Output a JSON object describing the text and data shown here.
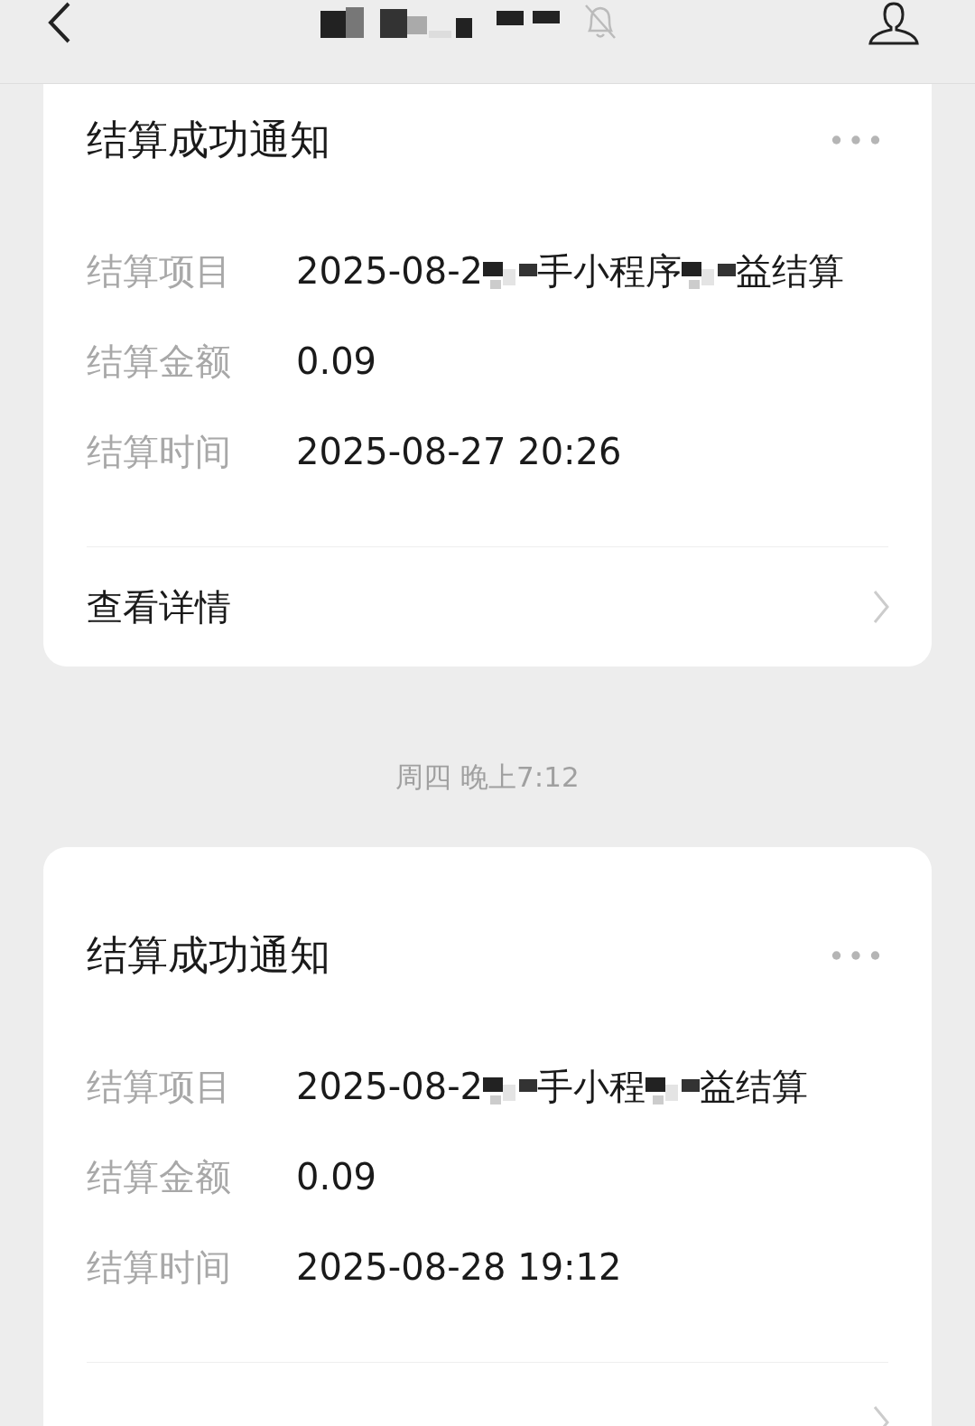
{
  "header": {
    "title_redacted": true,
    "muted": true
  },
  "messages": [
    {
      "title": "结算成功通知",
      "fields": [
        {
          "label": "结算项目",
          "parts": [
            {
              "kind": "text",
              "text": "2025-08-2"
            },
            {
              "kind": "redacted"
            },
            {
              "kind": "text",
              "text": "手小程序"
            },
            {
              "kind": "redacted"
            },
            {
              "kind": "text",
              "text": "益结算"
            }
          ]
        },
        {
          "label": "结算金额",
          "parts": [
            {
              "kind": "text",
              "text": "0.09"
            }
          ]
        },
        {
          "label": "结算时间",
          "parts": [
            {
              "kind": "text",
              "text": "2025-08-27 20:26"
            }
          ]
        }
      ],
      "link": "查看详情"
    },
    {
      "time": "周四 晚上7:12",
      "title": "结算成功通知",
      "fields": [
        {
          "label": "结算项目",
          "parts": [
            {
              "kind": "text",
              "text": "2025-08-2"
            },
            {
              "kind": "redacted"
            },
            {
              "kind": "text",
              "text": "手小程"
            },
            {
              "kind": "redacted"
            },
            {
              "kind": "text",
              "text": "益结算"
            }
          ]
        },
        {
          "label": "结算金额",
          "parts": [
            {
              "kind": "text",
              "text": "0.09"
            }
          ]
        },
        {
          "label": "结算时间",
          "parts": [
            {
              "kind": "text",
              "text": "2025-08-28 19:12"
            }
          ]
        }
      ]
    }
  ]
}
